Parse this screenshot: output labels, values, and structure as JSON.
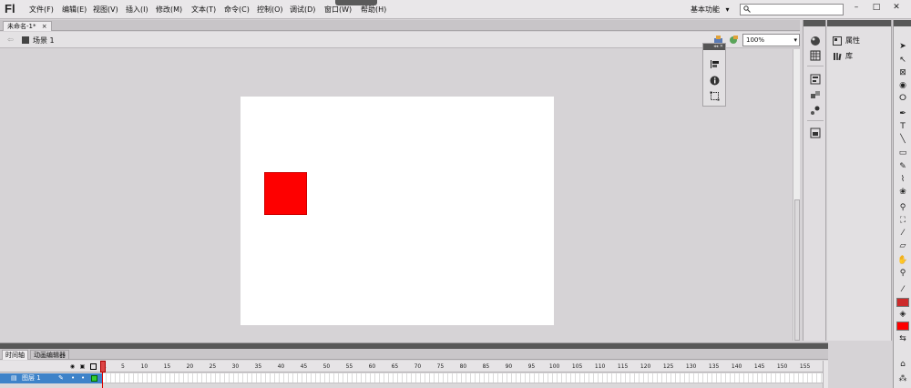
{
  "app": {
    "logo": "Fl",
    "menu": [
      "文件(F)",
      "编辑(E)",
      "视图(V)",
      "插入(I)",
      "修改(M)",
      "文本(T)",
      "命令(C)",
      "控制(O)",
      "调试(D)",
      "窗口(W)",
      "帮助(H)"
    ],
    "workspace_label": "基本功能",
    "workspace_caret": "▾",
    "search_value": "",
    "window_controls": [
      "–",
      "□",
      "✕"
    ]
  },
  "document": {
    "tab_label": "未命名-1*",
    "tab_close": "×",
    "scene_label": "场景 1",
    "zoom_value": "100%",
    "zoom_caret": "▾"
  },
  "stage": {
    "background": "#ffffff",
    "shape_color": "#fe0000"
  },
  "properties_panel": {
    "items": [
      "属性",
      "库"
    ]
  },
  "tools": {
    "stroke_color": "#cc2b2b",
    "fill_color": "#fe0000"
  },
  "timeline": {
    "tabs": [
      "时间轴",
      "动画编辑器"
    ],
    "ruler": [
      "1",
      "5",
      "10",
      "15",
      "20",
      "25",
      "30",
      "35",
      "40",
      "45",
      "50",
      "55",
      "60",
      "65",
      "70",
      "75",
      "80",
      "85",
      "90",
      "95",
      "100",
      "105",
      "110",
      "115",
      "120",
      "125",
      "130",
      "135",
      "140",
      "145",
      "150",
      "155"
    ],
    "layer_name": "图层 1",
    "layer_dot1": "•",
    "layer_dot2": "•"
  }
}
